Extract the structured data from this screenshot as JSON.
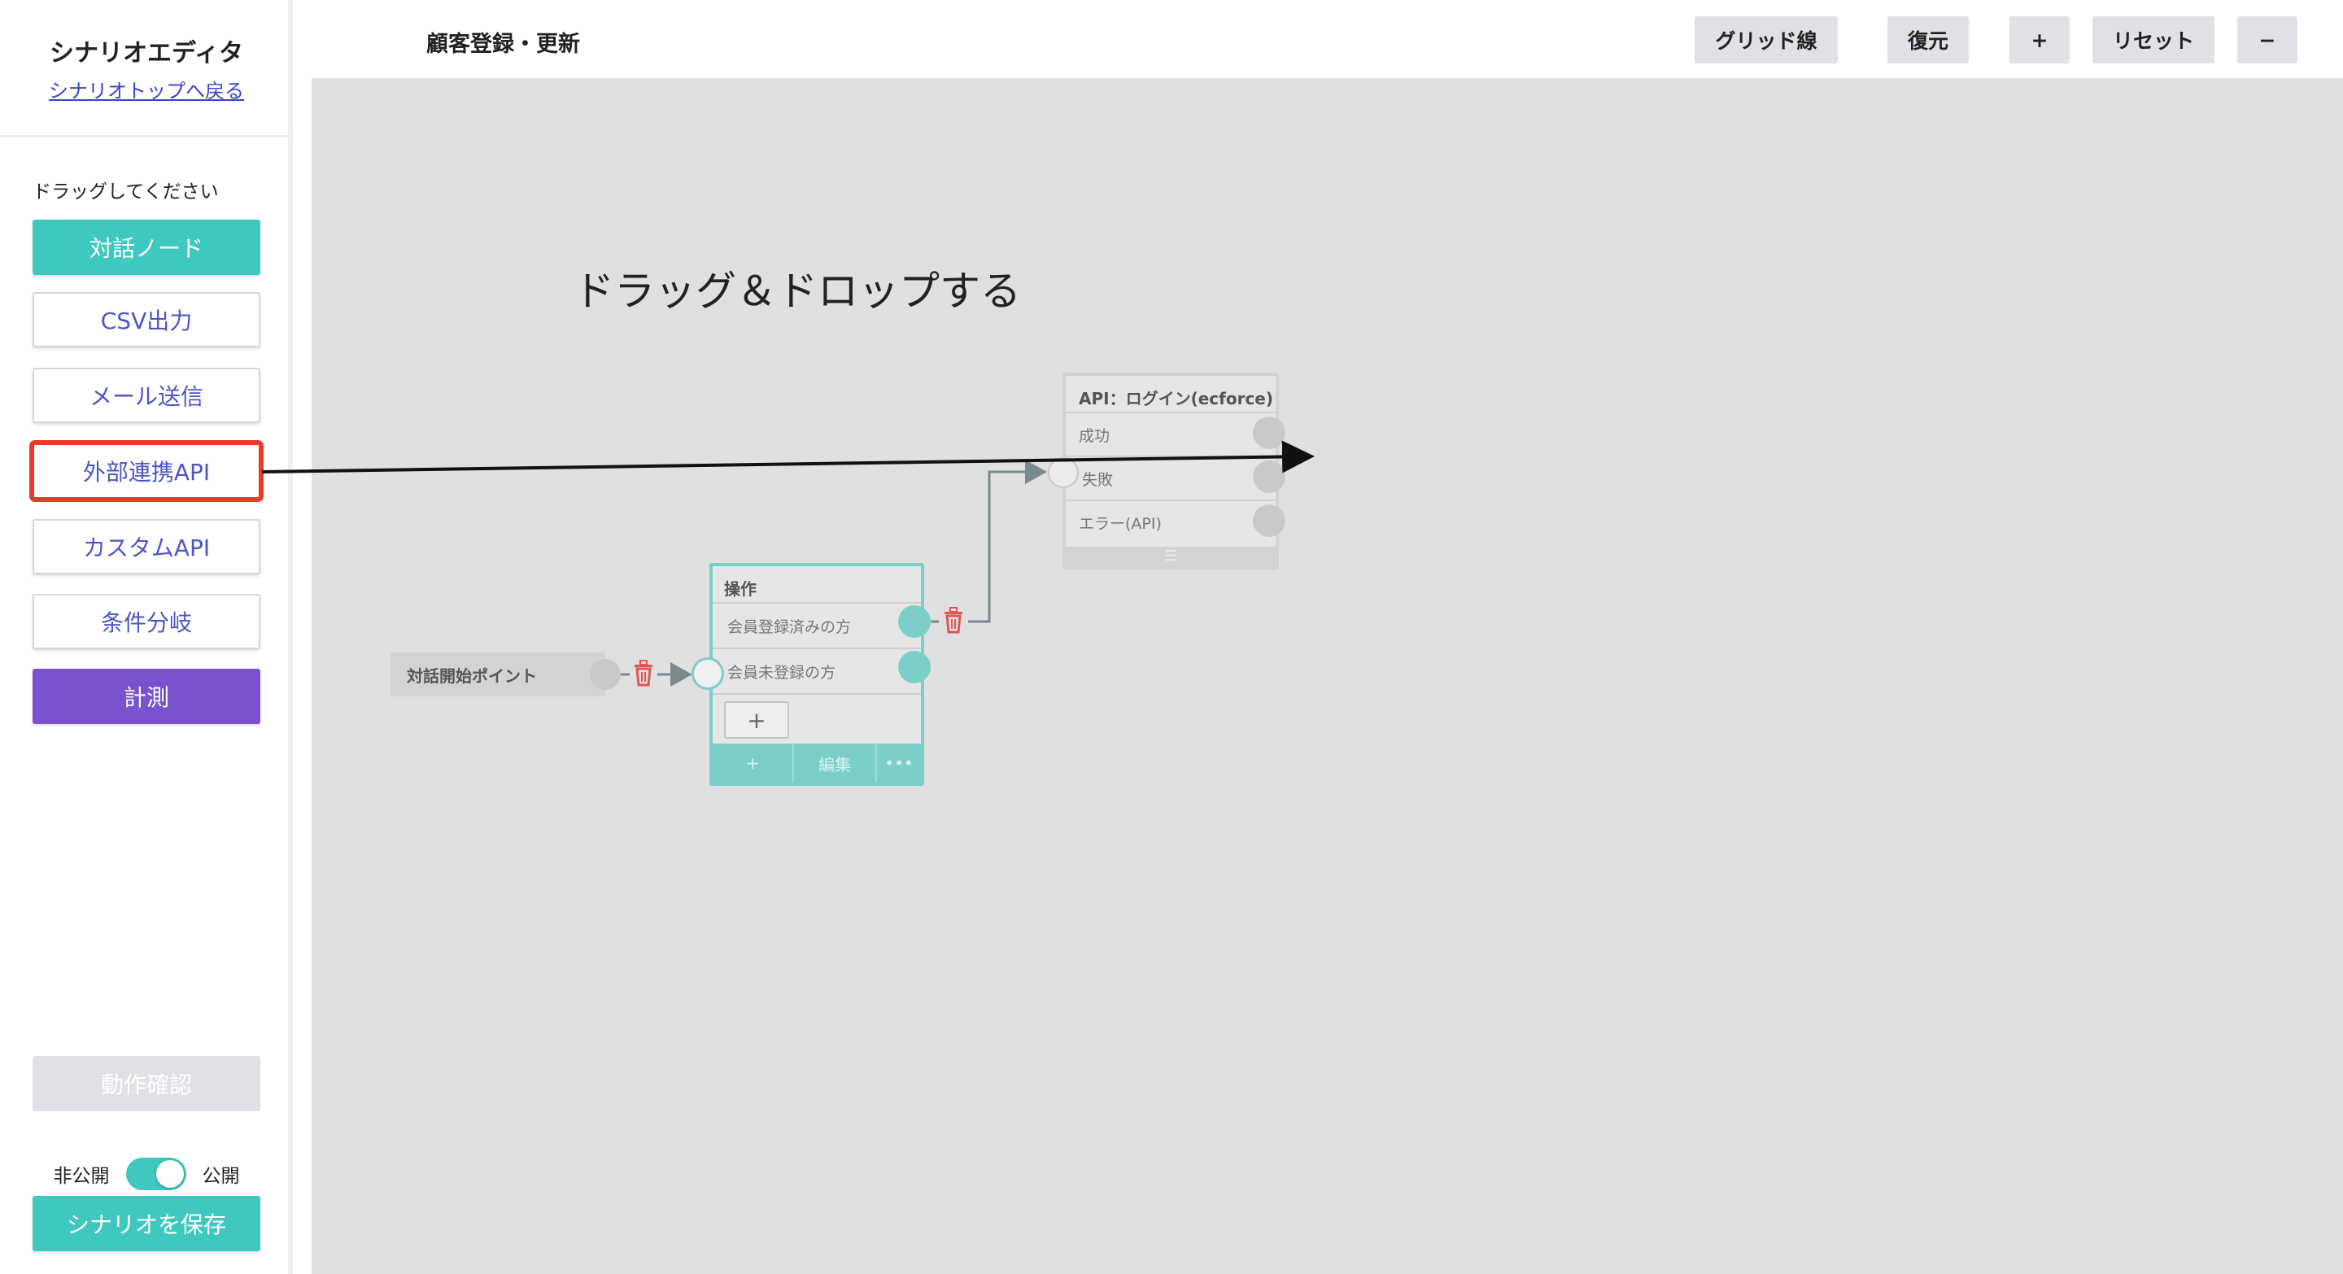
{
  "sidebar": {
    "title": "シナリオエディタ",
    "back_link": "シナリオトップへ戻る",
    "drag_hint": "ドラッグしてください",
    "nodes": [
      {
        "label": "対話ノード"
      },
      {
        "label": "CSV出力"
      },
      {
        "label": "メール送信"
      },
      {
        "label": "外部連携API",
        "highlighted": true
      },
      {
        "label": "カスタムAPI"
      },
      {
        "label": "条件分岐"
      },
      {
        "label": "計測"
      }
    ],
    "test_button": "動作確認",
    "private_label": "非公開",
    "public_label": "公開",
    "publish_toggle": "on",
    "save_button": "シナリオを保存"
  },
  "header": {
    "title": "顧客登録・更新",
    "buttons": {
      "grid": "グリッド線",
      "restore": "復元",
      "zoom_in": "+",
      "reset": "リセット",
      "zoom_out": "−"
    }
  },
  "canvas": {
    "annotation": "ドラッグ＆ドロップする",
    "start_node": {
      "label": "対話開始ポイント"
    },
    "operation_node": {
      "title": "操作",
      "options": [
        "会員登録済みの方",
        "会員未登録の方"
      ],
      "add_label": "+",
      "footer": {
        "add": "+",
        "edit": "編集",
        "more": "•••"
      }
    },
    "api_node": {
      "title": "API：ログイン(ecforce)",
      "outputs": [
        "成功",
        "失敗",
        "エラー(API)"
      ],
      "footer": "☰"
    }
  },
  "colors": {
    "teal": "#3fc8c0",
    "purple": "#7a52d0",
    "highlight": "#e8392a",
    "link": "#3b43c9",
    "canvas": "#e0e0e0",
    "delete": "#e05555"
  },
  "icons": {
    "delete": "trash-icon",
    "annotation_arrow": "arrow-right-icon"
  }
}
